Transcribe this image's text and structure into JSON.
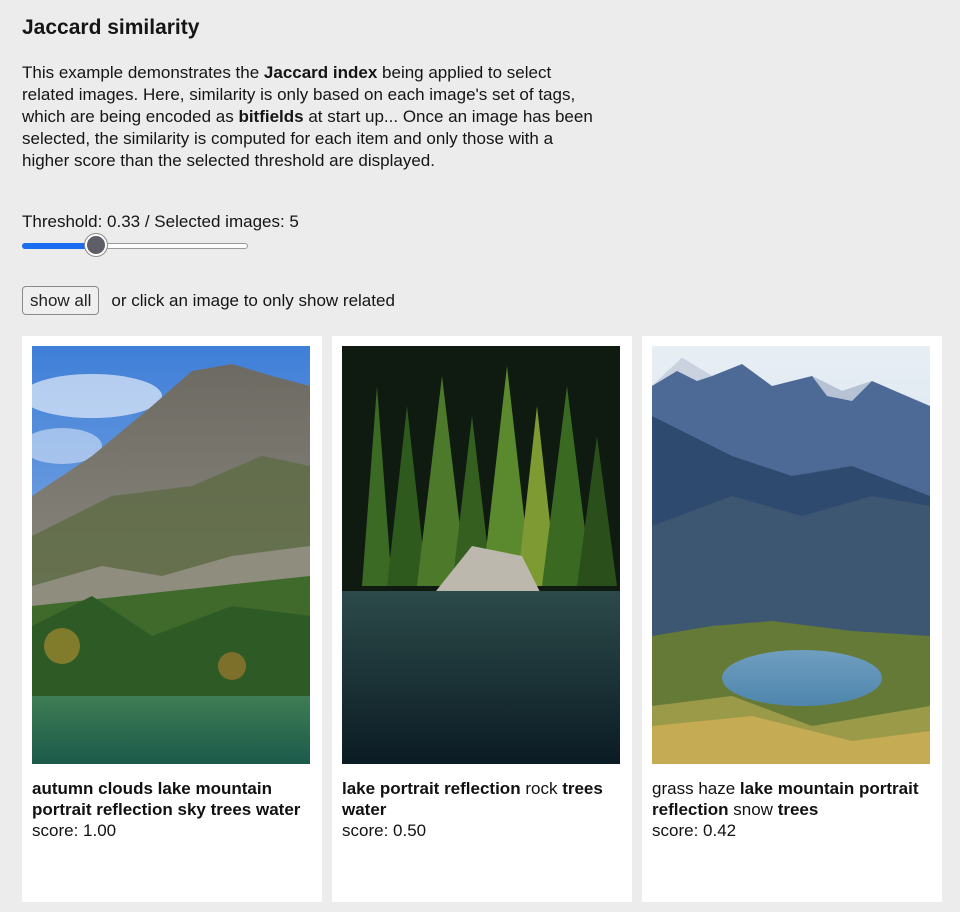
{
  "page": {
    "title": "Jaccard similarity",
    "intro": [
      {
        "t": "This example demonstrates the ",
        "b": false
      },
      {
        "t": "Jaccard index",
        "b": true
      },
      {
        "t": " being applied to select related images. Here, similarity is only based on each image's set of tags, which are being encoded as ",
        "b": false
      },
      {
        "t": "bitfields",
        "b": true
      },
      {
        "t": " at start up... Once an image has been selected, the similarity is computed for each item and only those with a higher score than the selected threshold are displayed.",
        "b": false
      }
    ]
  },
  "controls": {
    "threshold_text": "Threshold: 0.33 / Selected images: 5",
    "slider_value": 0.33,
    "show_all_label": "show all",
    "hint": "or click an image to only show related"
  },
  "cards": [
    {
      "image": "mountain-lake-autumn",
      "tags": [
        {
          "t": "autumn",
          "b": true
        },
        {
          "t": "clouds",
          "b": true
        },
        {
          "t": "lake",
          "b": true
        },
        {
          "t": "mountain",
          "b": true
        },
        {
          "t": "portrait",
          "b": true
        },
        {
          "t": "reflection",
          "b": true
        },
        {
          "t": "sky",
          "b": true
        },
        {
          "t": "trees",
          "b": true
        },
        {
          "t": "water",
          "b": true
        }
      ],
      "score": "score: 1.00"
    },
    {
      "image": "forest-lake-rock",
      "tags": [
        {
          "t": "lake",
          "b": true
        },
        {
          "t": "portrait",
          "b": true
        },
        {
          "t": "reflection",
          "b": true
        },
        {
          "t": "rock",
          "b": false
        },
        {
          "t": "trees",
          "b": true
        },
        {
          "t": "water",
          "b": true
        }
      ],
      "score": "score: 0.50"
    },
    {
      "image": "alpine-lake-valley",
      "tags": [
        {
          "t": "grass",
          "b": false
        },
        {
          "t": "haze",
          "b": false
        },
        {
          "t": "lake",
          "b": true
        },
        {
          "t": "mountain",
          "b": true
        },
        {
          "t": "portrait",
          "b": true
        },
        {
          "t": "reflection",
          "b": true
        },
        {
          "t": "snow",
          "b": false
        },
        {
          "t": "trees",
          "b": true
        }
      ],
      "score": "score: 0.42"
    }
  ],
  "colors": {
    "background": "#ececec",
    "slider_accent": "#1a6cf0",
    "card": "#ffffff"
  }
}
